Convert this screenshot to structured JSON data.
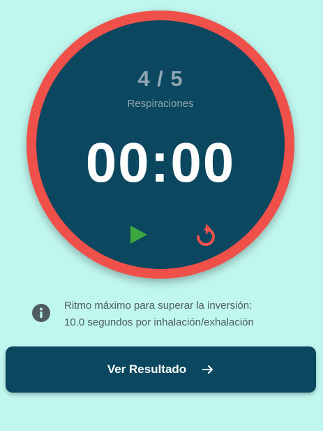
{
  "timer": {
    "count": "4 / 5",
    "count_label": "Respiraciones",
    "time": "00:00"
  },
  "controls": {
    "play_icon": "play-icon",
    "reset_icon": "reset-icon"
  },
  "info": {
    "icon": "info-icon",
    "line1": "Ritmo máximo para superar la inversión:",
    "line2": "10.0 segundos por inhalación/exhalación"
  },
  "result_button": {
    "label": "Ver Resultado",
    "icon": "arrow-right-icon"
  },
  "colors": {
    "background": "#bff6ee",
    "primary": "#0c4760",
    "ring": "#f0504a",
    "play": "#3da63f",
    "reset": "#f0504a",
    "muted_text": "#8fa6b2",
    "info_text": "#4e5b63"
  }
}
